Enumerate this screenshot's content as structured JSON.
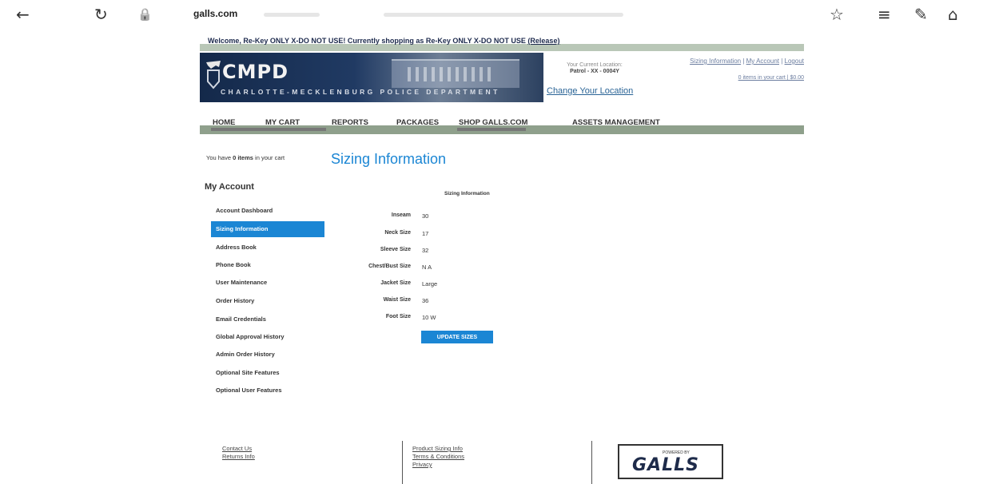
{
  "browser": {
    "url": "galls.com",
    "back_glyph": "←",
    "reload_glyph": "↻",
    "lock_glyph": "🔒",
    "favorite_glyph": "☆",
    "reading_glyph": "≡",
    "notes_glyph": "✎",
    "share_glyph": "⌂"
  },
  "welcome": {
    "text": "Welcome, Re-Key ONLY X-DO NOT USE!  Currently shopping as Re-Key ONLY X-DO NOT USE ",
    "release": "(Release)"
  },
  "header": {
    "logo_title": "CMPD",
    "logo_subtitle": "CHARLOTTE-MECKLENBURG POLICE DEPARTMENT",
    "location_label": "Your Current Location:",
    "location_value": "Patrol - XX - 0004Y",
    "change_location": "Change Your Location",
    "links": {
      "sizing": "Sizing Information",
      "account": "My Account",
      "logout": "Logout",
      "sep": " | "
    },
    "cart_summary": "0 items in your cart | $0.00"
  },
  "nav": {
    "home": "HOME",
    "my_cart": "MY CART",
    "reports": "REPORTS",
    "packages": "PACKAGES",
    "shop_galls": "SHOP GALLS.COM",
    "assets": "ASSETS MANAGEMENT"
  },
  "sidebar": {
    "cart_count_prefix": "You have ",
    "cart_count_items": "0 items",
    "cart_count_suffix": " in your cart",
    "title": "My Account",
    "items": [
      {
        "label": "Account Dashboard",
        "active": false
      },
      {
        "label": "Sizing Information",
        "active": true
      },
      {
        "label": "Address Book",
        "active": false
      },
      {
        "label": "Phone Book",
        "active": false
      },
      {
        "label": "User Maintenance",
        "active": false
      },
      {
        "label": "Order History",
        "active": false
      },
      {
        "label": "Email Credentials",
        "active": false
      },
      {
        "label": "Global Approval History",
        "active": false
      },
      {
        "label": "Admin Order History",
        "active": false
      },
      {
        "label": "Optional Site Features",
        "active": false
      },
      {
        "label": "Optional User Features",
        "active": false
      }
    ]
  },
  "main": {
    "heading": "Sizing Information",
    "section_title": "Sizing Information",
    "sizes": [
      {
        "label": "Inseam",
        "value": "30"
      },
      {
        "label": "Neck Size",
        "value": "17"
      },
      {
        "label": "Sleeve Size",
        "value": "32"
      },
      {
        "label": "Chest/Bust Size",
        "value": "N A"
      },
      {
        "label": "Jacket Size",
        "value": "Large"
      },
      {
        "label": "Waist Size",
        "value": "36"
      },
      {
        "label": "Foot Size",
        "value": "10 W"
      }
    ],
    "update_button": "UPDATE SIZES"
  },
  "footer": {
    "contact": "Contact Us",
    "returns": "Returns Info",
    "product_sizing": "Product Sizing Info",
    "terms": "Terms & Conditions",
    "privacy": "Privacy",
    "powered_by": "POWERED BY",
    "galls": "GALLS"
  },
  "colors": {
    "accent": "#1b86d4",
    "nav_bar": "#8fa08c",
    "banner_dark": "#14294a"
  }
}
